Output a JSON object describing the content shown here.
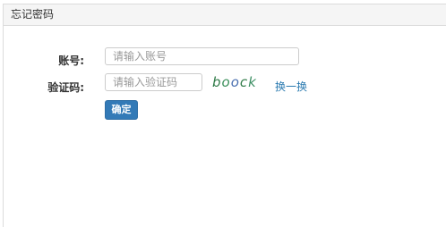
{
  "panel": {
    "title": "忘记密码"
  },
  "form": {
    "account_label": "账号:",
    "account_placeholder": "请输入账号",
    "captcha_label": "验证码:",
    "captcha_placeholder": "请输入验证码",
    "captcha_chars": [
      "b",
      "o",
      "o",
      "c",
      "k"
    ],
    "refresh_label": "换一换",
    "submit_label": "确定"
  },
  "colors": {
    "primary_button": "#337ab7",
    "link": "#2a7ab0",
    "header_bg": "#f5f5f5"
  }
}
